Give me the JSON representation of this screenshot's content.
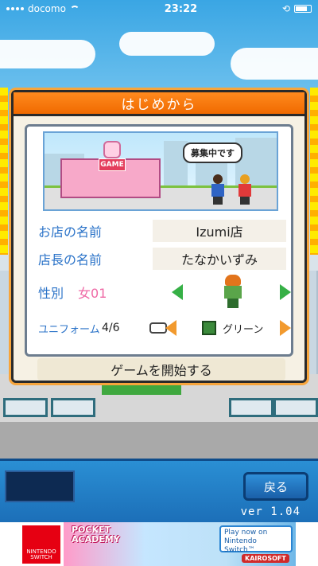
{
  "status_bar": {
    "carrier": "docomo",
    "time": "23:22"
  },
  "dialog": {
    "title": "はじめから",
    "scene": {
      "store_sign": "GAME",
      "bubble": "募集中です"
    },
    "shop_name": {
      "label": "お店の名前",
      "value": "Izumi店"
    },
    "manager_name": {
      "label": "店長の名前",
      "value": "たなかいずみ"
    },
    "gender": {
      "label": "性別",
      "value": "女01"
    },
    "uniform": {
      "label": "ユニフォーム",
      "count": "4/6",
      "name": "グリーン"
    },
    "start_label": "ゲームを開始する"
  },
  "bottom": {
    "back_label": "戻る",
    "version": "ver 1.04"
  },
  "ad": {
    "nintendo_line1": "NINTENDO",
    "nintendo_line2": "SWITCH",
    "game_logo_1": "POCKET",
    "game_logo_2": "ACADEMY",
    "play_now": "Play now on Nintendo Switch™",
    "publisher": "KAIROSOFT"
  }
}
